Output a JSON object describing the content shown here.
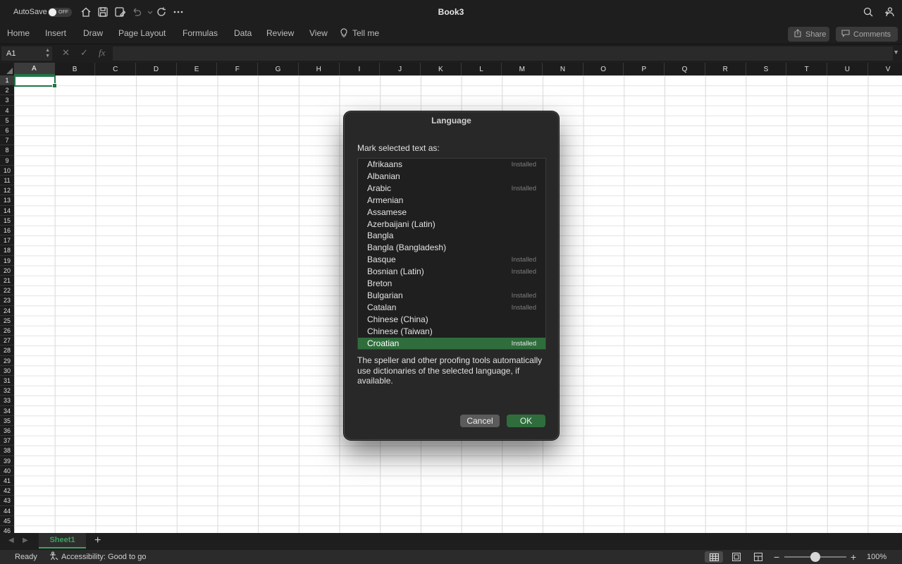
{
  "titlebar": {
    "autosave_label": "AutoSave",
    "autosave_state": "OFF",
    "doc_title": "Book3"
  },
  "ribbon": {
    "tabs": [
      "Home",
      "Insert",
      "Draw",
      "Page Layout",
      "Formulas",
      "Data",
      "Review",
      "View",
      "Tell me"
    ],
    "share_label": "Share",
    "comments_label": "Comments"
  },
  "formula_bar": {
    "name_box": "A1",
    "fx_label": "fx",
    "formula_value": ""
  },
  "grid": {
    "columns": [
      "A",
      "B",
      "C",
      "D",
      "E",
      "F",
      "G",
      "H",
      "I",
      "J",
      "K",
      "L",
      "M",
      "N",
      "O",
      "P",
      "Q",
      "R",
      "S",
      "T",
      "U",
      "V"
    ],
    "rows": [
      "1",
      "2",
      "3",
      "4",
      "5",
      "6",
      "7",
      "8",
      "9",
      "10",
      "11",
      "12",
      "13",
      "14",
      "15",
      "16",
      "17",
      "18",
      "19",
      "20",
      "21",
      "22",
      "23",
      "24",
      "25",
      "26",
      "27",
      "28",
      "29",
      "30",
      "31",
      "32",
      "33",
      "34",
      "35",
      "36",
      "37",
      "38",
      "39",
      "40",
      "41",
      "42",
      "43",
      "44",
      "45",
      "46"
    ],
    "selected_cell": "A1"
  },
  "sheets": {
    "tabs": [
      "Sheet1"
    ],
    "add_label": "+"
  },
  "status": {
    "ready": "Ready",
    "accessibility": "Accessibility: Good to go",
    "zoom_minus": "−",
    "zoom_plus": "+",
    "zoom_percent": "100%",
    "zoom_level": 0.5
  },
  "dialog": {
    "title": "Language",
    "prompt": "Mark selected text as:",
    "languages": [
      {
        "name": "Afrikaans",
        "status": "Installed"
      },
      {
        "name": "Albanian",
        "status": ""
      },
      {
        "name": "Arabic",
        "status": "Installed"
      },
      {
        "name": "Armenian",
        "status": ""
      },
      {
        "name": "Assamese",
        "status": ""
      },
      {
        "name": "Azerbaijani (Latin)",
        "status": ""
      },
      {
        "name": "Bangla",
        "status": ""
      },
      {
        "name": "Bangla (Bangladesh)",
        "status": ""
      },
      {
        "name": "Basque",
        "status": "Installed"
      },
      {
        "name": "Bosnian (Latin)",
        "status": "Installed"
      },
      {
        "name": "Breton",
        "status": ""
      },
      {
        "name": "Bulgarian",
        "status": "Installed"
      },
      {
        "name": "Catalan",
        "status": "Installed"
      },
      {
        "name": "Chinese (China)",
        "status": ""
      },
      {
        "name": "Chinese (Taiwan)",
        "status": ""
      },
      {
        "name": "Croatian",
        "status": "Installed"
      }
    ],
    "selected_language": "Croatian",
    "note": "The speller and other proofing tools automatically use dictionaries of the selected language, if available.",
    "cancel_label": "Cancel",
    "ok_label": "OK"
  },
  "colors": {
    "accent_green": "#2f6e3c",
    "excel_green": "#217346",
    "chrome_dark": "#1e1e1e"
  }
}
